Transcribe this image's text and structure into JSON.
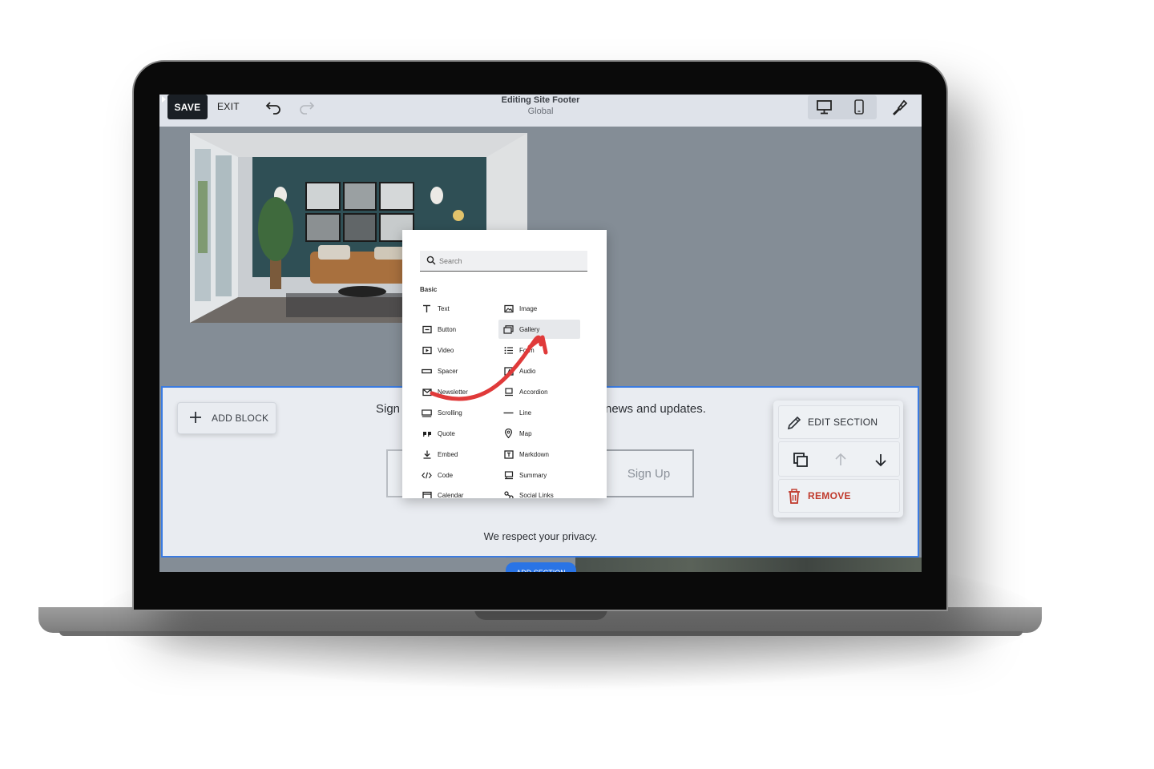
{
  "topbar": {
    "save_label": "SAVE",
    "exit_label": "EXIT",
    "title": "Editing Site Footer",
    "subtitle": "Global"
  },
  "footer": {
    "add_block_label": "ADD BLOCK",
    "signup_left": "Sign",
    "signup_right": "news and updates.",
    "signup_button": "Sign Up",
    "privacy": "We respect your privacy.",
    "add_section": "ADD SECTION"
  },
  "section_controls": {
    "edit_label": "EDIT SECTION",
    "remove_label": "REMOVE"
  },
  "picker": {
    "search_placeholder": "Search",
    "category": "Basic",
    "left_items": [
      "Text",
      "Button",
      "Video",
      "Spacer",
      "Newsletter",
      "Scrolling",
      "Quote",
      "Embed",
      "Code",
      "Calendar"
    ],
    "right_items": [
      "Image",
      "Gallery",
      "Form",
      "Audio",
      "Accordion",
      "Line",
      "Map",
      "Markdown",
      "Summary",
      "Social Links"
    ],
    "selected": "Gallery"
  },
  "colors": {
    "accent_blue": "#3b7be0",
    "remove_red": "#c0392b",
    "arrow_red": "#e03a3a"
  }
}
